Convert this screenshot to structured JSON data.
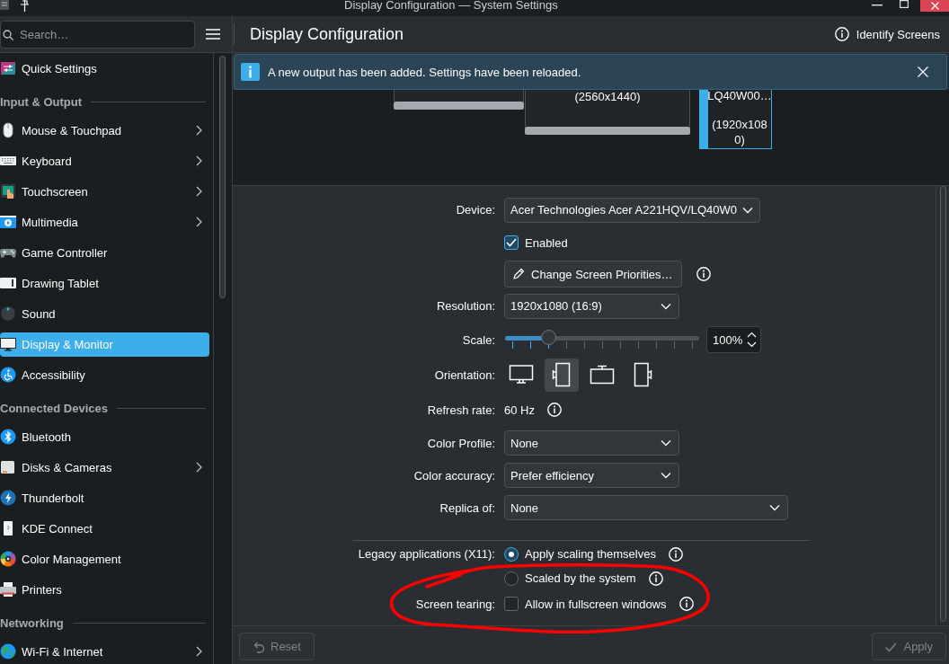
{
  "window": {
    "title": "Display Configuration — System Settings"
  },
  "sidebar": {
    "search": {
      "placeholder": "Search…"
    },
    "items": [
      {
        "kind": "item",
        "label": "Quick Settings",
        "selected": false,
        "has_submenu": false
      },
      {
        "kind": "section",
        "label": "Input & Output"
      },
      {
        "kind": "item",
        "label": "Mouse & Touchpad",
        "selected": false,
        "has_submenu": true
      },
      {
        "kind": "item",
        "label": "Keyboard",
        "selected": false,
        "has_submenu": true
      },
      {
        "kind": "item",
        "label": "Touchscreen",
        "selected": false,
        "has_submenu": true
      },
      {
        "kind": "item",
        "label": "Multimedia",
        "selected": false,
        "has_submenu": true
      },
      {
        "kind": "item",
        "label": "Game Controller",
        "selected": false,
        "has_submenu": false
      },
      {
        "kind": "item",
        "label": "Drawing Tablet",
        "selected": false,
        "has_submenu": false
      },
      {
        "kind": "item",
        "label": "Sound",
        "selected": false,
        "has_submenu": false
      },
      {
        "kind": "item",
        "label": "Display & Monitor",
        "selected": true,
        "has_submenu": false
      },
      {
        "kind": "item",
        "label": "Accessibility",
        "selected": false,
        "has_submenu": false
      },
      {
        "kind": "section",
        "label": "Connected Devices"
      },
      {
        "kind": "item",
        "label": "Bluetooth",
        "selected": false,
        "has_submenu": false
      },
      {
        "kind": "item",
        "label": "Disks & Cameras",
        "selected": false,
        "has_submenu": true
      },
      {
        "kind": "item",
        "label": "Thunderbolt",
        "selected": false,
        "has_submenu": false
      },
      {
        "kind": "item",
        "label": "KDE Connect",
        "selected": false,
        "has_submenu": false
      },
      {
        "kind": "item",
        "label": "Color Management",
        "selected": false,
        "has_submenu": false
      },
      {
        "kind": "item",
        "label": "Printers",
        "selected": false,
        "has_submenu": false
      },
      {
        "kind": "section",
        "label": "Networking"
      },
      {
        "kind": "item",
        "label": "Wi-Fi & Internet",
        "selected": false,
        "has_submenu": true
      }
    ]
  },
  "header": {
    "title": "Display Configuration",
    "identify_button": "Identify Screens"
  },
  "notification": {
    "message": "A new output has been added. Settings have been reloaded."
  },
  "screens": [
    {
      "selected": false
    },
    {
      "resolution": "(2560x1440)",
      "selected": false
    },
    {
      "name": "LQ40W00…",
      "resolution": "(1920x1080)",
      "selected": true
    }
  ],
  "form": {
    "rows": [
      {
        "kind": "combo",
        "label": "Device:",
        "value": "Acer Technologies Acer A221HQV/LQ40W0",
        "info": false
      },
      {
        "kind": "checkbox",
        "text": "Enabled",
        "checked": true,
        "info": false
      },
      {
        "kind": "button",
        "text": "Change Screen Priorities…",
        "info": true
      },
      {
        "kind": "combo",
        "label": "Resolution:",
        "value": "1920x1080 (16:9)",
        "info": false
      },
      {
        "kind": "slider",
        "label": "Scale:",
        "level": 0.2,
        "reading": "100%",
        "info": false
      },
      {
        "kind": "orientation",
        "label": "Orientation:",
        "options": [
          {
            "selected": false
          },
          {
            "selected": true
          },
          {
            "selected": false
          },
          {
            "selected": false
          }
        ],
        "info": false
      },
      {
        "kind": "text",
        "label": "Refresh rate:",
        "value": "60 Hz",
        "info": true
      },
      {
        "kind": "combo",
        "label": "Color Profile:",
        "value": "None",
        "info": false
      },
      {
        "kind": "combo",
        "label": "Color accuracy:",
        "value": "Prefer efficiency",
        "info": false
      },
      {
        "kind": "combo",
        "label": "Replica of:",
        "value": "None",
        "info": false
      },
      {
        "kind": "separator"
      },
      {
        "kind": "radio",
        "label": "Legacy applications (X11):",
        "options": [
          {
            "text": "Apply scaling themselves",
            "selected": true,
            "info": true
          },
          {
            "text": "Scaled by the system",
            "selected": false,
            "info": true
          }
        ]
      },
      {
        "kind": "checkbox",
        "label": "Screen tearing:",
        "text": "Allow in fullscreen windows",
        "checked": false,
        "info": true
      }
    ]
  },
  "footer": {
    "buttons": [
      {
        "label": "Reset",
        "disabled": true
      },
      {
        "label": "Apply",
        "disabled": true
      }
    ]
  },
  "annotations": [
    {
      "kind": "freehand-circle"
    }
  ]
}
